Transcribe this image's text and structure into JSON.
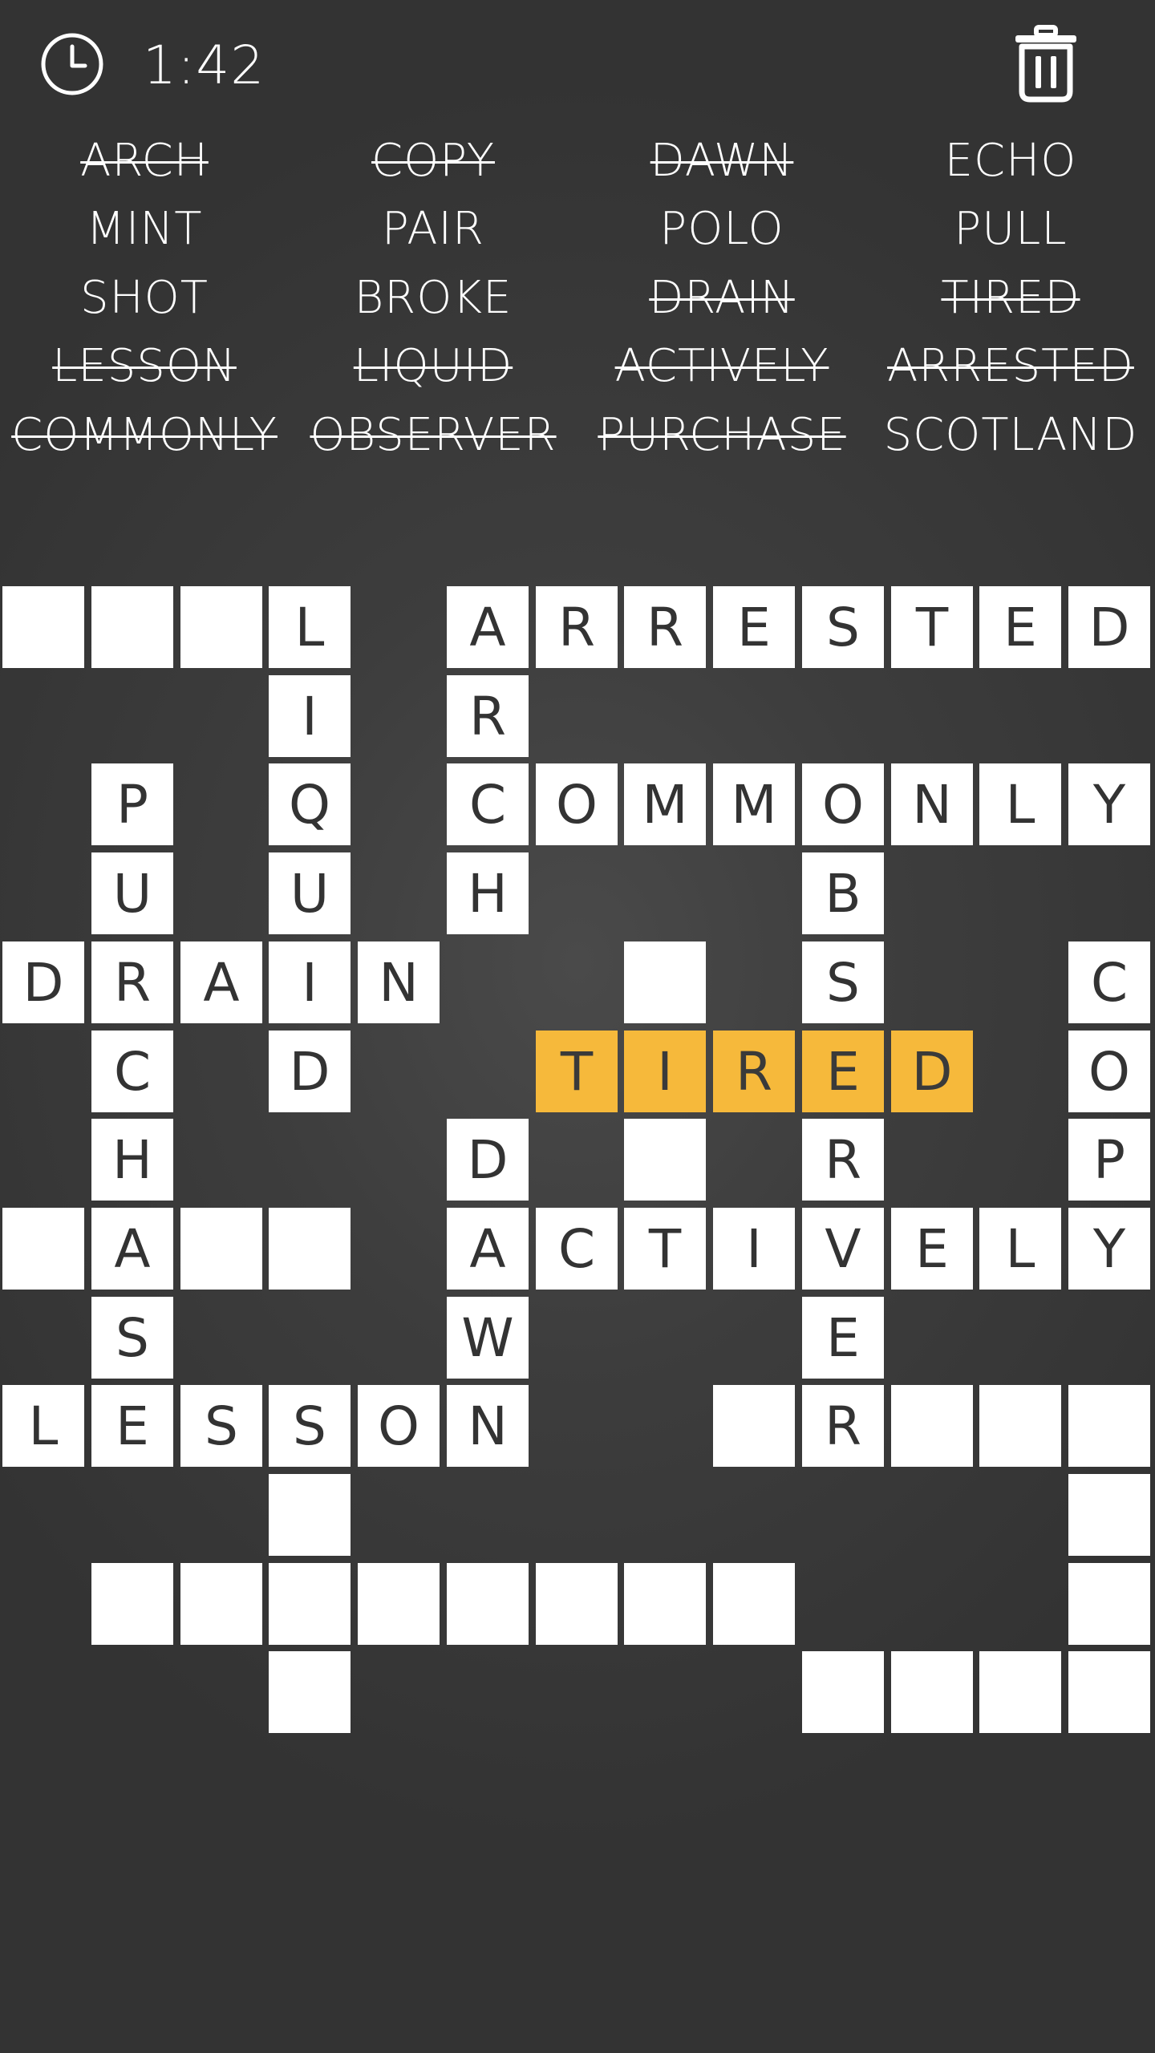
{
  "header": {
    "clock_icon": "clock-icon",
    "timer": "1:42",
    "trash_icon": "trash-icon"
  },
  "word_list": [
    [
      {
        "text": "ARCH",
        "found": true
      },
      {
        "text": "COPY",
        "found": true
      },
      {
        "text": "DAWN",
        "found": true
      },
      {
        "text": "ECHO",
        "found": false
      }
    ],
    [
      {
        "text": "MINT",
        "found": false
      },
      {
        "text": "PAIR",
        "found": false
      },
      {
        "text": "POLO",
        "found": false
      },
      {
        "text": "PULL",
        "found": false
      }
    ],
    [
      {
        "text": "SHOT",
        "found": false
      },
      {
        "text": "BROKE",
        "found": false
      },
      {
        "text": "DRAIN",
        "found": true
      },
      {
        "text": "TIRED",
        "found": true
      }
    ],
    [
      {
        "text": "LESSON",
        "found": true
      },
      {
        "text": "LIQUID",
        "found": true
      },
      {
        "text": "ACTIVELY",
        "found": true
      },
      {
        "text": "ARRESTED",
        "found": true
      }
    ],
    [
      {
        "text": "COMMONLY",
        "found": true
      },
      {
        "text": "OBSERVER",
        "found": true
      },
      {
        "text": "PURCHASE",
        "found": true
      },
      {
        "text": "SCOTLAND",
        "found": false
      }
    ]
  ],
  "colors": {
    "highlight": "#f6b93b",
    "cell": "#ffffff",
    "cell_text": "#333333",
    "background": "#3d3d3d"
  },
  "grid": {
    "rows": 13,
    "cols": 13,
    "highlighted_word": "TIRED",
    "cells": [
      {
        "r": 0,
        "c": 0,
        "ch": ""
      },
      {
        "r": 0,
        "c": 1,
        "ch": ""
      },
      {
        "r": 0,
        "c": 2,
        "ch": ""
      },
      {
        "r": 0,
        "c": 3,
        "ch": "L"
      },
      {
        "r": 0,
        "c": 5,
        "ch": "A"
      },
      {
        "r": 0,
        "c": 6,
        "ch": "R"
      },
      {
        "r": 0,
        "c": 7,
        "ch": "R"
      },
      {
        "r": 0,
        "c": 8,
        "ch": "E"
      },
      {
        "r": 0,
        "c": 9,
        "ch": "S"
      },
      {
        "r": 0,
        "c": 10,
        "ch": "T"
      },
      {
        "r": 0,
        "c": 11,
        "ch": "E"
      },
      {
        "r": 0,
        "c": 12,
        "ch": "D"
      },
      {
        "r": 1,
        "c": 3,
        "ch": "I"
      },
      {
        "r": 1,
        "c": 5,
        "ch": "R"
      },
      {
        "r": 2,
        "c": 1,
        "ch": "P"
      },
      {
        "r": 2,
        "c": 3,
        "ch": "Q"
      },
      {
        "r": 2,
        "c": 5,
        "ch": "C"
      },
      {
        "r": 2,
        "c": 6,
        "ch": "O"
      },
      {
        "r": 2,
        "c": 7,
        "ch": "M"
      },
      {
        "r": 2,
        "c": 8,
        "ch": "M"
      },
      {
        "r": 2,
        "c": 9,
        "ch": "O"
      },
      {
        "r": 2,
        "c": 10,
        "ch": "N"
      },
      {
        "r": 2,
        "c": 11,
        "ch": "L"
      },
      {
        "r": 2,
        "c": 12,
        "ch": "Y"
      },
      {
        "r": 3,
        "c": 1,
        "ch": "U"
      },
      {
        "r": 3,
        "c": 3,
        "ch": "U"
      },
      {
        "r": 3,
        "c": 5,
        "ch": "H"
      },
      {
        "r": 3,
        "c": 9,
        "ch": "B"
      },
      {
        "r": 4,
        "c": 0,
        "ch": "D"
      },
      {
        "r": 4,
        "c": 1,
        "ch": "R"
      },
      {
        "r": 4,
        "c": 2,
        "ch": "A"
      },
      {
        "r": 4,
        "c": 3,
        "ch": "I"
      },
      {
        "r": 4,
        "c": 4,
        "ch": "N"
      },
      {
        "r": 4,
        "c": 7,
        "ch": ""
      },
      {
        "r": 4,
        "c": 9,
        "ch": "S"
      },
      {
        "r": 4,
        "c": 12,
        "ch": "C"
      },
      {
        "r": 5,
        "c": 1,
        "ch": "C"
      },
      {
        "r": 5,
        "c": 3,
        "ch": "D"
      },
      {
        "r": 5,
        "c": 6,
        "ch": "T",
        "hl": true
      },
      {
        "r": 5,
        "c": 7,
        "ch": "I",
        "hl": true
      },
      {
        "r": 5,
        "c": 8,
        "ch": "R",
        "hl": true
      },
      {
        "r": 5,
        "c": 9,
        "ch": "E",
        "hl": true
      },
      {
        "r": 5,
        "c": 10,
        "ch": "D",
        "hl": true
      },
      {
        "r": 5,
        "c": 12,
        "ch": "O"
      },
      {
        "r": 6,
        "c": 1,
        "ch": "H"
      },
      {
        "r": 6,
        "c": 5,
        "ch": "D"
      },
      {
        "r": 6,
        "c": 7,
        "ch": ""
      },
      {
        "r": 6,
        "c": 9,
        "ch": "R"
      },
      {
        "r": 6,
        "c": 12,
        "ch": "P"
      },
      {
        "r": 7,
        "c": 0,
        "ch": ""
      },
      {
        "r": 7,
        "c": 1,
        "ch": "A"
      },
      {
        "r": 7,
        "c": 2,
        "ch": ""
      },
      {
        "r": 7,
        "c": 3,
        "ch": ""
      },
      {
        "r": 7,
        "c": 5,
        "ch": "A"
      },
      {
        "r": 7,
        "c": 6,
        "ch": "C"
      },
      {
        "r": 7,
        "c": 7,
        "ch": "T"
      },
      {
        "r": 7,
        "c": 8,
        "ch": "I"
      },
      {
        "r": 7,
        "c": 9,
        "ch": "V"
      },
      {
        "r": 7,
        "c": 10,
        "ch": "E"
      },
      {
        "r": 7,
        "c": 11,
        "ch": "L"
      },
      {
        "r": 7,
        "c": 12,
        "ch": "Y"
      },
      {
        "r": 8,
        "c": 1,
        "ch": "S"
      },
      {
        "r": 8,
        "c": 5,
        "ch": "W"
      },
      {
        "r": 8,
        "c": 9,
        "ch": "E"
      },
      {
        "r": 9,
        "c": 0,
        "ch": "L"
      },
      {
        "r": 9,
        "c": 1,
        "ch": "E"
      },
      {
        "r": 9,
        "c": 2,
        "ch": "S"
      },
      {
        "r": 9,
        "c": 3,
        "ch": "S"
      },
      {
        "r": 9,
        "c": 4,
        "ch": "O"
      },
      {
        "r": 9,
        "c": 5,
        "ch": "N"
      },
      {
        "r": 9,
        "c": 8,
        "ch": ""
      },
      {
        "r": 9,
        "c": 9,
        "ch": "R"
      },
      {
        "r": 9,
        "c": 10,
        "ch": ""
      },
      {
        "r": 9,
        "c": 11,
        "ch": ""
      },
      {
        "r": 9,
        "c": 12,
        "ch": ""
      },
      {
        "r": 10,
        "c": 3,
        "ch": ""
      },
      {
        "r": 10,
        "c": 12,
        "ch": ""
      },
      {
        "r": 11,
        "c": 1,
        "ch": ""
      },
      {
        "r": 11,
        "c": 2,
        "ch": ""
      },
      {
        "r": 11,
        "c": 3,
        "ch": ""
      },
      {
        "r": 11,
        "c": 4,
        "ch": ""
      },
      {
        "r": 11,
        "c": 5,
        "ch": ""
      },
      {
        "r": 11,
        "c": 6,
        "ch": ""
      },
      {
        "r": 11,
        "c": 7,
        "ch": ""
      },
      {
        "r": 11,
        "c": 8,
        "ch": ""
      },
      {
        "r": 11,
        "c": 12,
        "ch": ""
      },
      {
        "r": 12,
        "c": 3,
        "ch": ""
      },
      {
        "r": 12,
        "c": 9,
        "ch": ""
      },
      {
        "r": 12,
        "c": 10,
        "ch": ""
      },
      {
        "r": 12,
        "c": 11,
        "ch": ""
      },
      {
        "r": 12,
        "c": 12,
        "ch": ""
      }
    ]
  }
}
